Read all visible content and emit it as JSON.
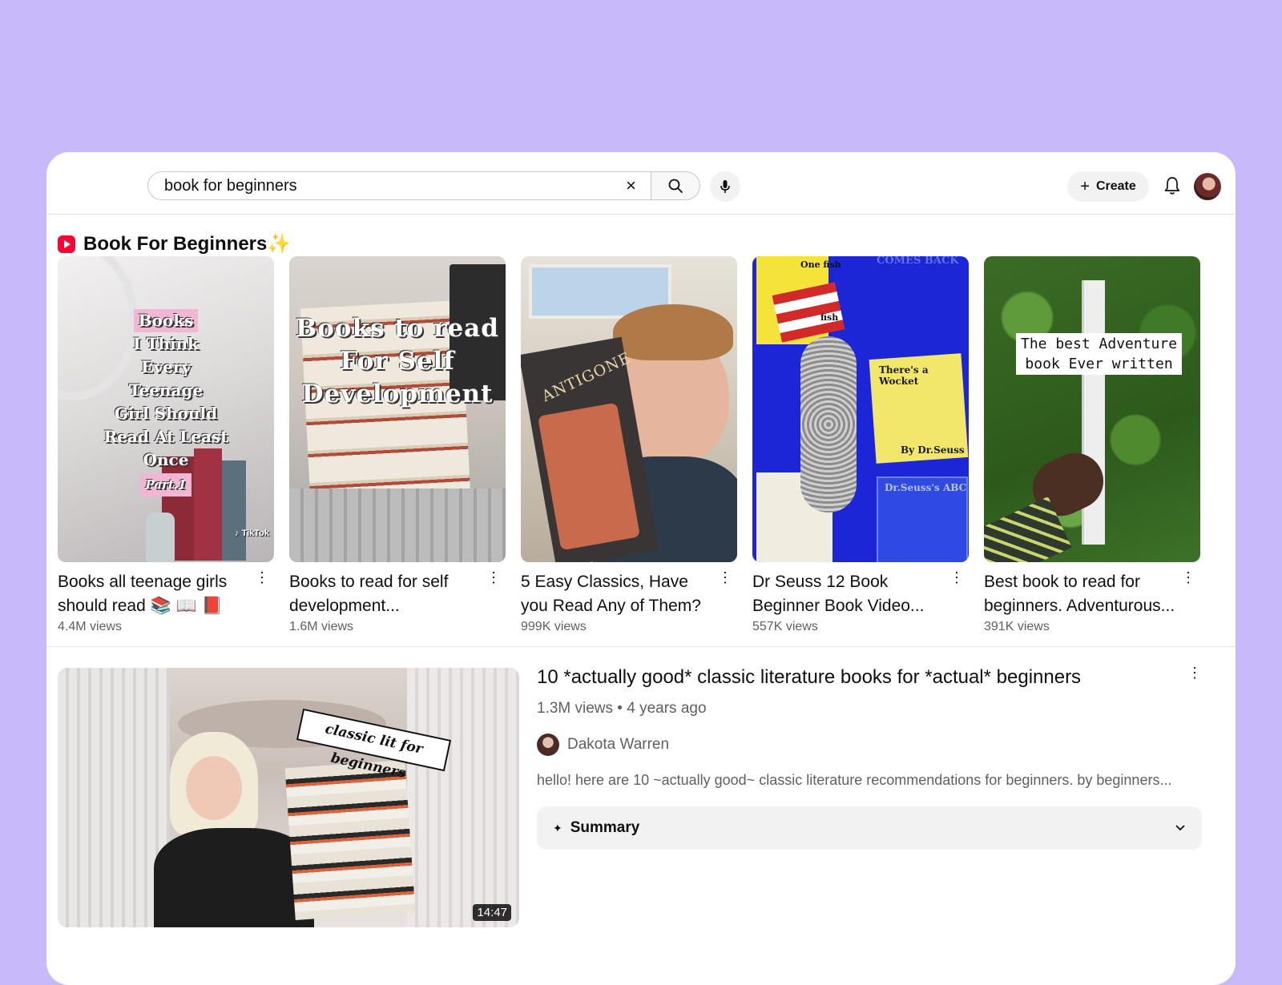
{
  "search": {
    "value": "book for beginners"
  },
  "header": {
    "create_label": "Create"
  },
  "shelf": {
    "title": "Book For Beginners",
    "title_emoji": "✨",
    "items": [
      {
        "thumb_text": [
          "Books",
          "I Think",
          "Every",
          "Teenage",
          "Girl Should",
          "Read At Least",
          "Once",
          "Part.1"
        ],
        "badge": "TikTok",
        "title": "Books all teenage girls should read 📚 📖 📕",
        "views": "4.4M views"
      },
      {
        "thumb_text": [
          "Books to read",
          "For Self",
          "Development"
        ],
        "title": "Books to read for self development...",
        "views": "1.6M views"
      },
      {
        "thumb_text": [
          "ANTIGONE"
        ],
        "title": "5 Easy Classics, Have you Read Any of Them?",
        "views": "999K views"
      },
      {
        "thumb_text": [
          "One fish",
          "fish",
          "COMES BACK",
          "There's a Wocket",
          "By Dr.Seuss",
          "Dr.Seuss's ABC"
        ],
        "title": "Dr Seuss 12 Book Beginner Book Video...",
        "views": "557K views"
      },
      {
        "thumb_text": [
          "The best Adventure",
          "book Ever written"
        ],
        "title": "Best book to read for beginners. Adventurous...",
        "views": "391K views"
      }
    ]
  },
  "video": {
    "thumb_banner": "classic lit for beginners",
    "duration": "14:47",
    "title": "10 *actually good* classic literature books for *actual* beginners",
    "meta": "1.3M views • 4 years ago",
    "channel": "Dakota Warren",
    "description": "hello! here are 10 ~actually good~ classic literature recommendations for beginners. by beginners...",
    "summary_label": "Summary"
  }
}
